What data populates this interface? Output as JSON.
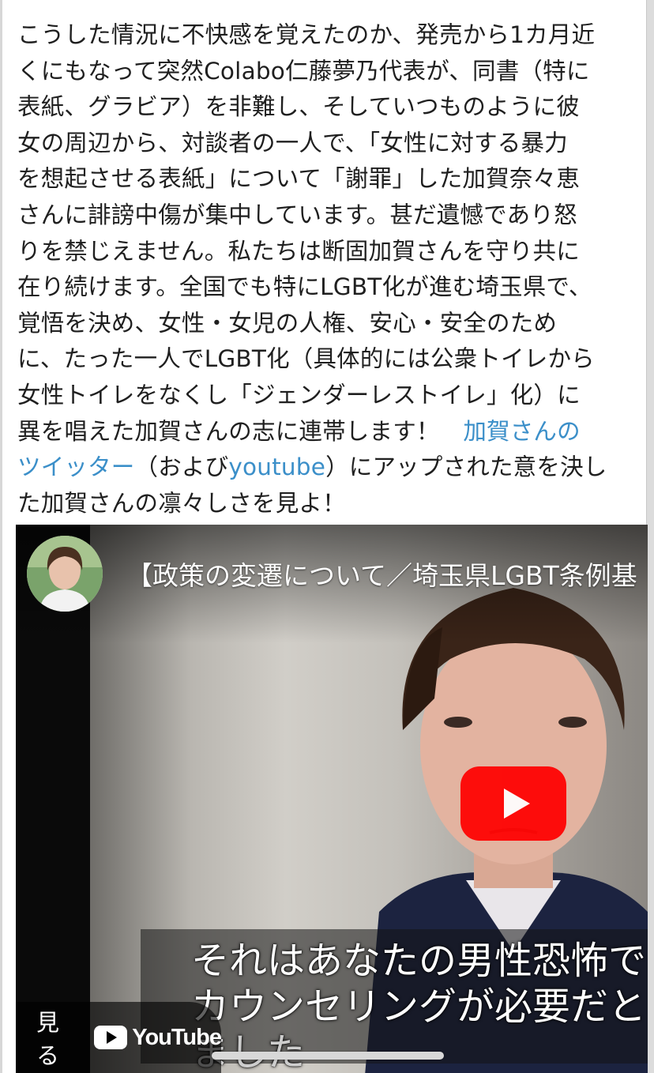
{
  "article": {
    "line1": "こうした情況に不快感を覚えたのか、発売から1カ月近",
    "line2": "くにもなって突然Colabo仁藤夢乃代表が、同書（特に",
    "line3": "表紙、グラビア）を非難し、そしていつものように彼",
    "line4": "女の周辺から、対談者の一人で、「女性に対する暴力",
    "line5": "を想起させる表紙」について「謝罪」した加賀奈々恵",
    "line6": "さんに誹謗中傷が集中しています。甚だ遺憾であり怒",
    "line7": "りを禁じえません。私たちは断固加賀さんを守り共に",
    "line8": "在り続けます。全国でも特にLGBT化が進む埼玉県で、",
    "line9": "覚悟を決め、女性・女児の人権、安心・安全のため",
    "line10": "に、たった一人でLGBT化（具体的には公衆トイレから",
    "line11": "女性トイレをなくし「ジェンダーレストイレ」化）に",
    "line12_text": "異を唱えた加賀さんの志に連帯します！　",
    "line12_link": "加賀さんの",
    "line13_link": "ツイッター",
    "line13_mid": "（および",
    "line13_link2": "youtube",
    "line13_end": "）にアップされた意を決し",
    "line14": "た加賀さんの凛々しさを見よ！"
  },
  "video": {
    "title": "【政策の変遷について／埼玉県LGBT条例基",
    "subtitle_line1": "それはあなたの男性恐怖で",
    "subtitle_line2": "カウンセリングが必要だと",
    "subtitle_line3": "ました",
    "watch_label": "見る",
    "youtube_logo_text": "YouTube",
    "play_icon": "play-icon",
    "youtube_red": "#ff0000"
  },
  "colors": {
    "link": "#3b8fc9",
    "text": "#1f1f1f"
  }
}
